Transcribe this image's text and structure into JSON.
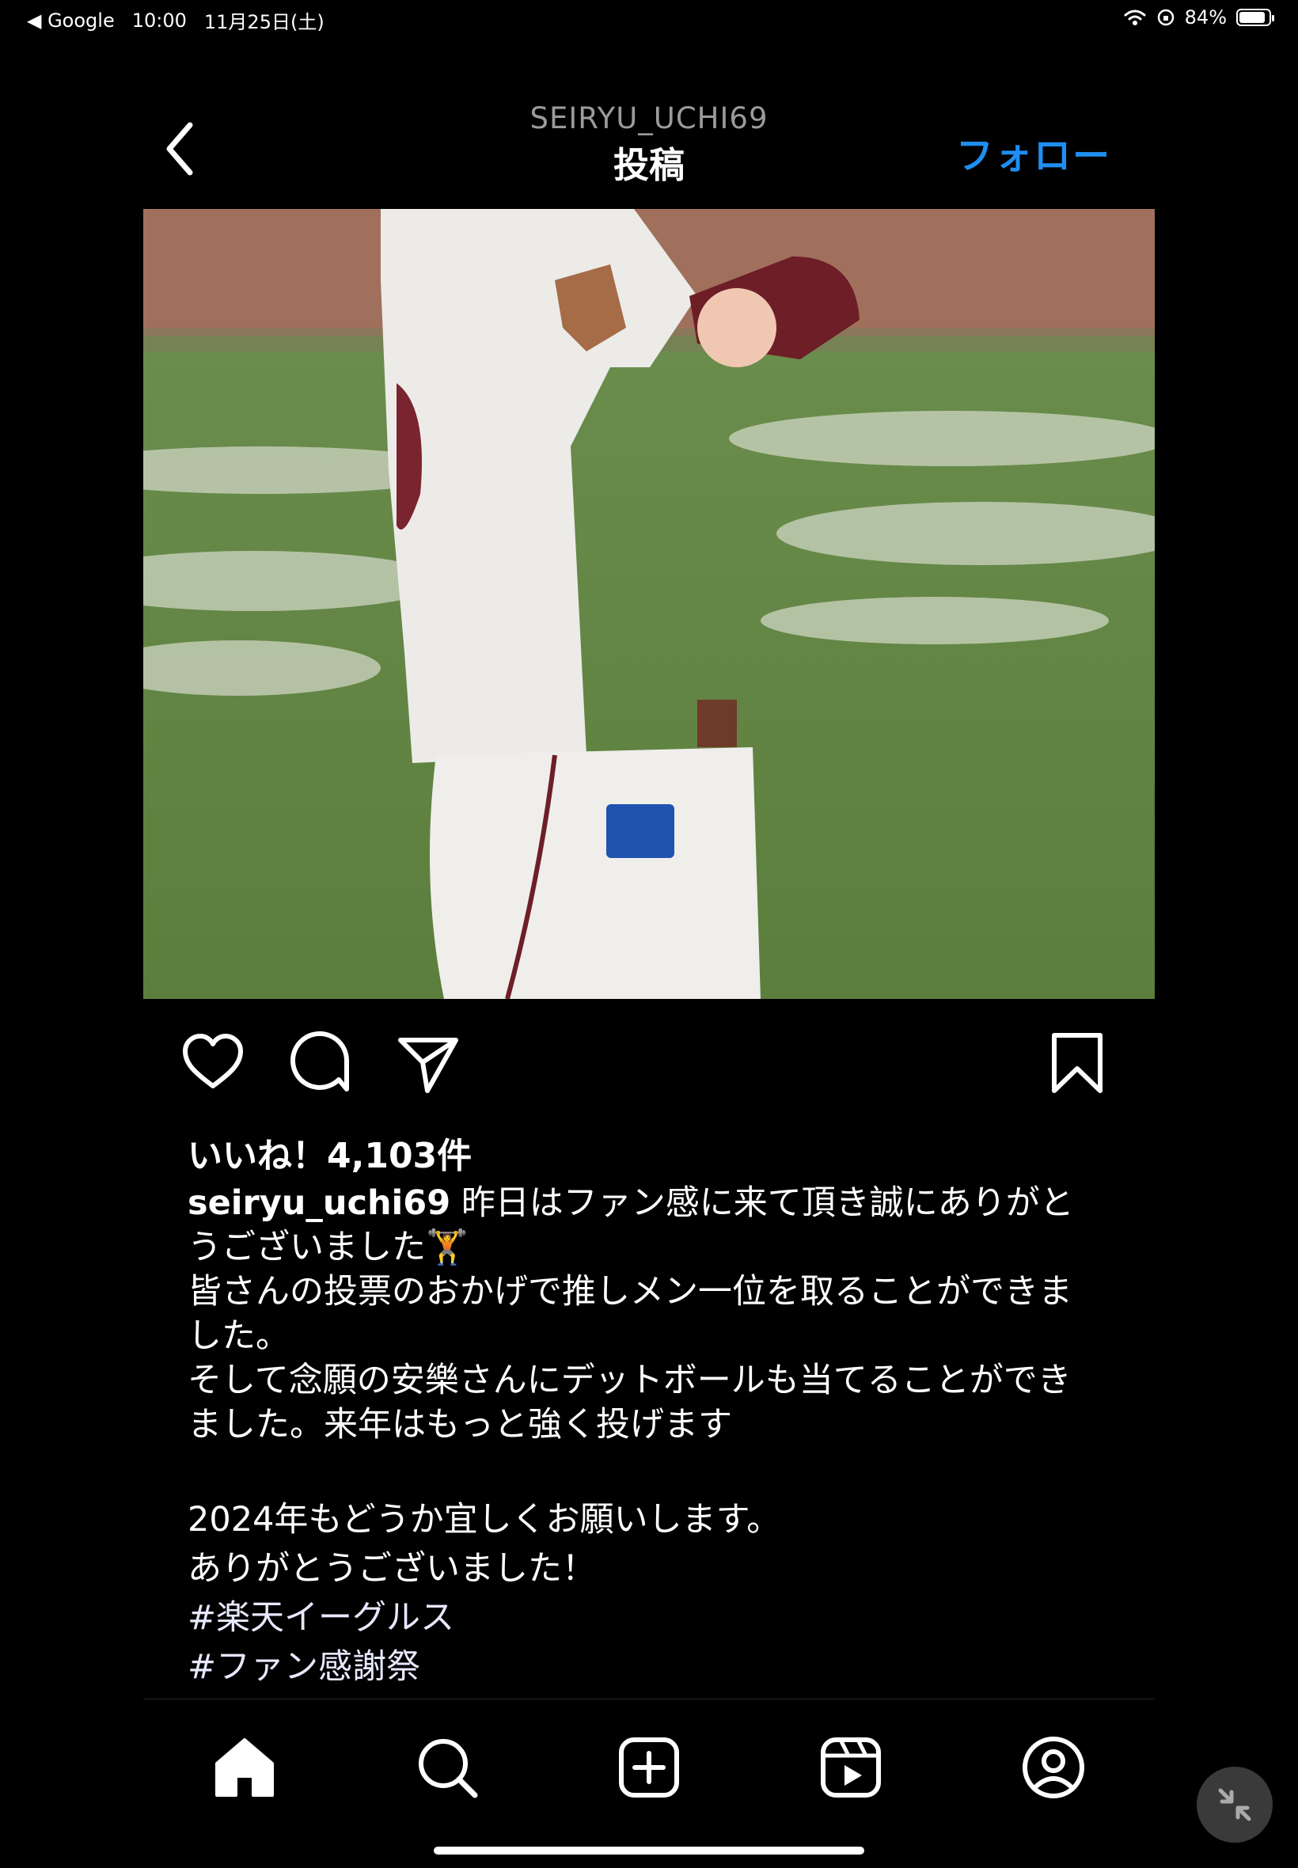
{
  "status_bar": {
    "back_app": "◀ Google",
    "time": "10:00",
    "date": "11月25日(土)",
    "battery": "84%"
  },
  "header": {
    "username": "SEIRYU_UCHI69",
    "title": "投稿",
    "follow": "フォロー"
  },
  "post": {
    "likes": "いいね！4,103件",
    "caption_user": "seiryu_uchi69",
    "caption_lines": [
      "昨日はファン感に来て頂き誠にありがと",
      "うございました🏋",
      "皆さんの投票のおかげで推しメン一位を取ることができま",
      "した。",
      "そして念願の安樂さんにデットボールも当てることができ",
      "ました。来年はもっと強く投げます",
      "2024年もどうか宜しくお願いします。",
      "ありがとうございました！"
    ],
    "hashtags": [
      "#楽天イーグルス",
      "#ファン感謝祭"
    ]
  },
  "icons": {
    "back": "chevron-left-icon",
    "like": "heart-icon",
    "comment": "comment-icon",
    "share": "send-icon",
    "save": "bookmark-icon",
    "home": "home-icon",
    "search": "search-icon",
    "create": "plus-square-icon",
    "reels": "reels-icon",
    "profile": "profile-icon",
    "minimize": "minimize-icon"
  },
  "colors": {
    "background": "#000000",
    "follow_accent": "#1f8ef1"
  }
}
